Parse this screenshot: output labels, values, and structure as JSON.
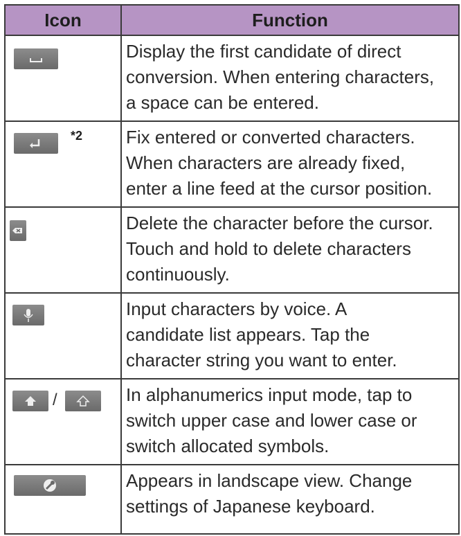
{
  "table": {
    "headers": {
      "icon": "Icon",
      "function": "Function"
    },
    "rows": [
      {
        "icon": "space-key",
        "function": "Display the first candidate of direct\nconversion. When entering characters,\na space can be entered."
      },
      {
        "icon": "enter-key",
        "note": "*2",
        "function": "Fix entered or converted characters.\nWhen characters are already fixed,\nenter a line feed at the cursor position."
      },
      {
        "icon": "delete-key",
        "function": "Delete the character before the cursor.\nTouch and hold to delete characters\ncontinuously."
      },
      {
        "icon": "microphone-key",
        "function": "Input characters by voice. A\ncandidate list appears. Tap the\ncharacter string you want to enter."
      },
      {
        "icon": "shift-key",
        "separator": "/",
        "function": "In alphanumerics input mode, tap to\nswitch upper case and lower case or\nswitch allocated symbols."
      },
      {
        "icon": "settings-key",
        "function": "Appears in landscape view. Change\nsettings of Japanese keyboard."
      }
    ]
  },
  "colors": {
    "header_bg": "#b694c4",
    "border": "#3a3a3a",
    "key_bg": "#7a7a7a"
  }
}
